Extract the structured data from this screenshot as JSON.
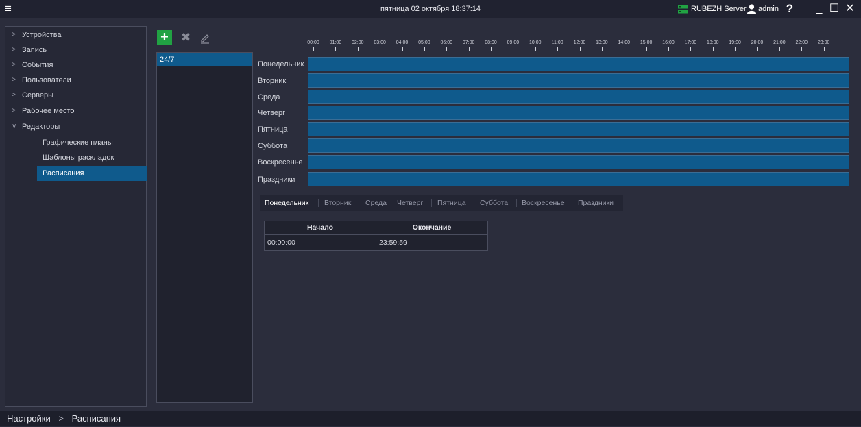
{
  "titlebar": {
    "datetime": "пятница 02 октября 18:37:14",
    "server": "RUBEZH Server",
    "user": "admin",
    "help": "?",
    "minimize": "_",
    "maximize": "☐",
    "close": "✕"
  },
  "sidebar": {
    "items": [
      {
        "label": "Устройства",
        "chevron": ">"
      },
      {
        "label": "Запись",
        "chevron": ">"
      },
      {
        "label": "События",
        "chevron": ">"
      },
      {
        "label": "Пользователи",
        "chevron": ">"
      },
      {
        "label": "Серверы",
        "chevron": ">"
      },
      {
        "label": "Рабочее место",
        "chevron": ">"
      },
      {
        "label": "Редакторы",
        "chevron": "∨"
      }
    ],
    "subitems": [
      {
        "label": "Графические планы"
      },
      {
        "label": "Шаблоны раскладок"
      },
      {
        "label": "Расписания"
      }
    ]
  },
  "toolbar": {
    "add": "+",
    "delete": "✖"
  },
  "schedules": [
    {
      "name": "24/7"
    }
  ],
  "timeline": {
    "hours": [
      "00:00",
      "01:00",
      "02:00",
      "03:00",
      "04:00",
      "05:00",
      "06:00",
      "07:00",
      "08:00",
      "09:00",
      "10:00",
      "11:00",
      "12:00",
      "13:00",
      "14:00",
      "15:00",
      "16:00",
      "17:00",
      "18:00",
      "19:00",
      "20:00",
      "21:00",
      "22:00",
      "23:00"
    ],
    "days": [
      {
        "label": "Понедельник",
        "start": "00:00",
        "end": "24:00"
      },
      {
        "label": "Вторник",
        "start": "00:00",
        "end": "24:00"
      },
      {
        "label": "Среда",
        "start": "00:00",
        "end": "24:00"
      },
      {
        "label": "Четверг",
        "start": "00:00",
        "end": "24:00"
      },
      {
        "label": "Пятница",
        "start": "00:00",
        "end": "24:00"
      },
      {
        "label": "Суббота",
        "start": "00:00",
        "end": "24:00"
      },
      {
        "label": "Воскресенье",
        "start": "00:00",
        "end": "24:00"
      },
      {
        "label": "Праздники",
        "start": "00:00",
        "end": "24:00"
      }
    ]
  },
  "tabs": [
    "Понедельник",
    "Вторник",
    "Среда",
    "Четверг",
    "Пятница",
    "Суббота",
    "Воскресенье",
    "Праздники"
  ],
  "intervals": {
    "headers": {
      "start": "Начало",
      "end": "Окончание"
    },
    "rows": [
      {
        "start": "00:00:00",
        "end": "23:59:59"
      }
    ]
  },
  "breadcrumb": {
    "root": "Настройки",
    "sep": ">",
    "current": "Расписания"
  },
  "colors": {
    "accent": "#0f5a8c",
    "add_button": "#21a243",
    "server_icon": "#21a243"
  }
}
